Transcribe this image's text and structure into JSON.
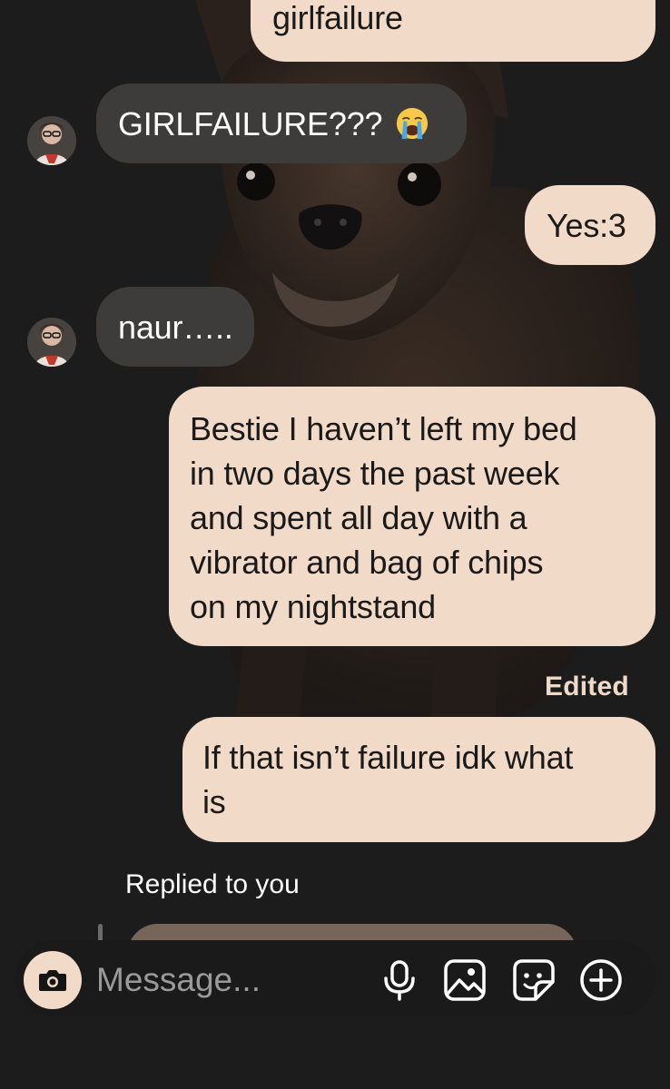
{
  "messages": [
    {
      "direction": "out",
      "text": "girlfailure"
    },
    {
      "direction": "in",
      "text": "GIRLFAILURE???",
      "emoji": "loudly-crying-face"
    },
    {
      "direction": "out",
      "text": "Yes:3"
    },
    {
      "direction": "in",
      "text": "naur….."
    },
    {
      "direction": "out",
      "lines": [
        "Bestie I haven’t left my bed",
        "in two days the past week",
        "and spent all day with a",
        "vibrator and bag of chips",
        "on my nightstand"
      ]
    },
    {
      "direction": "out",
      "edited_label": "Edited",
      "lines": [
        "If that isn’t failure idk what",
        "is"
      ]
    }
  ],
  "reply": {
    "label": "Replied to you"
  },
  "composer": {
    "placeholder": "Message...",
    "value": ""
  },
  "icons": {
    "camera": "camera-icon",
    "mic": "microphone-icon",
    "gallery": "gallery-icon",
    "sticker": "sticker-icon",
    "add": "add-icon"
  },
  "colors": {
    "outgoing_bubble": "#f1dac8",
    "incoming_bubble": "#3e3c3a",
    "background": "#1c1c1c",
    "edited_label": "#efd9c7"
  }
}
